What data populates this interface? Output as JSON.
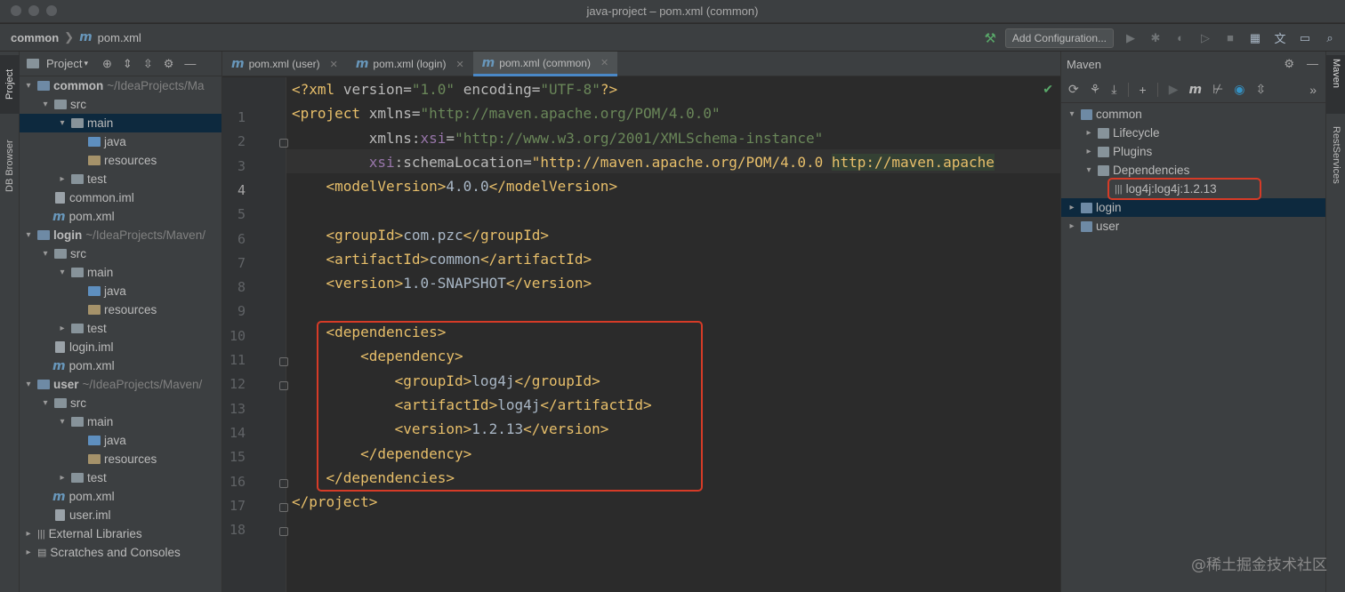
{
  "window": {
    "title": "java-project – pom.xml (common)"
  },
  "navbar": {
    "breadcrumb_module": "common",
    "breadcrumb_file": "pom.xml",
    "add_configuration": "Add Configuration..."
  },
  "left_stripe": {
    "project_tab": "Project",
    "db_browser_tab": "DB Browser"
  },
  "project_panel": {
    "title": "Project",
    "tree": [
      {
        "label": "common",
        "suffix": "~/IdeaProjects/Ma",
        "bold": true,
        "depth": 0,
        "expanded": true,
        "icon": "module-folder-icon"
      },
      {
        "label": "src",
        "depth": 1,
        "expanded": true,
        "icon": "folder-icon"
      },
      {
        "label": "main",
        "depth": 2,
        "expanded": true,
        "icon": "folder-icon",
        "selected": true
      },
      {
        "label": "java",
        "depth": 3,
        "icon": "java-source-folder-icon"
      },
      {
        "label": "resources",
        "depth": 3,
        "icon": "resources-folder-icon"
      },
      {
        "label": "test",
        "depth": 2,
        "expanded": false,
        "icon": "folder-icon"
      },
      {
        "label": "common.iml",
        "depth": 1,
        "icon": "iml-file-icon"
      },
      {
        "label": "pom.xml",
        "depth": 1,
        "icon": "maven-file-icon"
      },
      {
        "label": "login",
        "suffix": "~/IdeaProjects/Maven/",
        "bold": true,
        "depth": 0,
        "expanded": true,
        "icon": "module-folder-icon"
      },
      {
        "label": "src",
        "depth": 1,
        "expanded": true,
        "icon": "folder-icon"
      },
      {
        "label": "main",
        "depth": 2,
        "expanded": true,
        "icon": "folder-icon"
      },
      {
        "label": "java",
        "depth": 3,
        "icon": "java-source-folder-icon"
      },
      {
        "label": "resources",
        "depth": 3,
        "icon": "resources-folder-icon"
      },
      {
        "label": "test",
        "depth": 2,
        "expanded": false,
        "icon": "folder-icon"
      },
      {
        "label": "login.iml",
        "depth": 1,
        "icon": "iml-file-icon"
      },
      {
        "label": "pom.xml",
        "depth": 1,
        "icon": "maven-file-icon"
      },
      {
        "label": "user",
        "suffix": "~/IdeaProjects/Maven/",
        "bold": true,
        "depth": 0,
        "expanded": true,
        "icon": "module-folder-icon"
      },
      {
        "label": "src",
        "depth": 1,
        "expanded": true,
        "icon": "folder-icon"
      },
      {
        "label": "main",
        "depth": 2,
        "expanded": true,
        "icon": "folder-icon"
      },
      {
        "label": "java",
        "depth": 3,
        "icon": "java-source-folder-icon"
      },
      {
        "label": "resources",
        "depth": 3,
        "icon": "resources-folder-icon"
      },
      {
        "label": "test",
        "depth": 2,
        "expanded": false,
        "icon": "folder-icon"
      },
      {
        "label": "pom.xml",
        "depth": 1,
        "icon": "maven-file-icon"
      },
      {
        "label": "user.iml",
        "depth": 1,
        "icon": "iml-file-icon"
      },
      {
        "label": "External Libraries",
        "depth": 0,
        "expanded": false,
        "icon": "library-icon"
      },
      {
        "label": "Scratches and Consoles",
        "depth": 0,
        "expanded": false,
        "icon": "scratches-icon"
      }
    ]
  },
  "editor": {
    "tabs": [
      {
        "label": "pom.xml (user)",
        "active": false
      },
      {
        "label": "pom.xml (login)",
        "active": false
      },
      {
        "label": "pom.xml (common)",
        "active": true
      }
    ],
    "current_line": 4,
    "lines": [
      "<?xml version=\"1.0\" encoding=\"UTF-8\"?>",
      "<project xmlns=\"http://maven.apache.org/POM/4.0.0\"",
      "         xmlns:xsi=\"http://www.w3.org/2001/XMLSchema-instance\"",
      "         xsi:schemaLocation=\"http://maven.apache.org/POM/4.0.0 http://maven.apache",
      "    <modelVersion>4.0.0</modelVersion>",
      "",
      "    <groupId>com.pzc</groupId>",
      "    <artifactId>common</artifactId>",
      "    <version>1.0-SNAPSHOT</version>",
      "",
      "    <dependencies>",
      "        <dependency>",
      "            <groupId>log4j</groupId>",
      "            <artifactId>log4j</artifactId>",
      "            <version>1.2.13</version>",
      "        </dependency>",
      "    </dependencies>",
      "</project>"
    ]
  },
  "maven_panel": {
    "title": "Maven",
    "tree": [
      {
        "label": "common",
        "depth": 0,
        "expanded": true
      },
      {
        "label": "Lifecycle",
        "depth": 1,
        "expanded": false
      },
      {
        "label": "Plugins",
        "depth": 1,
        "expanded": false
      },
      {
        "label": "Dependencies",
        "depth": 1,
        "expanded": true
      },
      {
        "label": "log4j:log4j:1.2.13",
        "depth": 2,
        "highlighted": true
      },
      {
        "label": "login",
        "depth": 0,
        "expanded": false,
        "selected": true
      },
      {
        "label": "user",
        "depth": 0,
        "expanded": false
      }
    ]
  },
  "right_stripe": {
    "maven_tab": "Maven",
    "rest_tab": "RestServices"
  },
  "watermark": "@稀土掘金技术社区",
  "colors": {
    "highlight_box": "#d63b27",
    "accent": "#4a88c7",
    "tag": "#e8bf6a",
    "string": "#6a8759"
  }
}
